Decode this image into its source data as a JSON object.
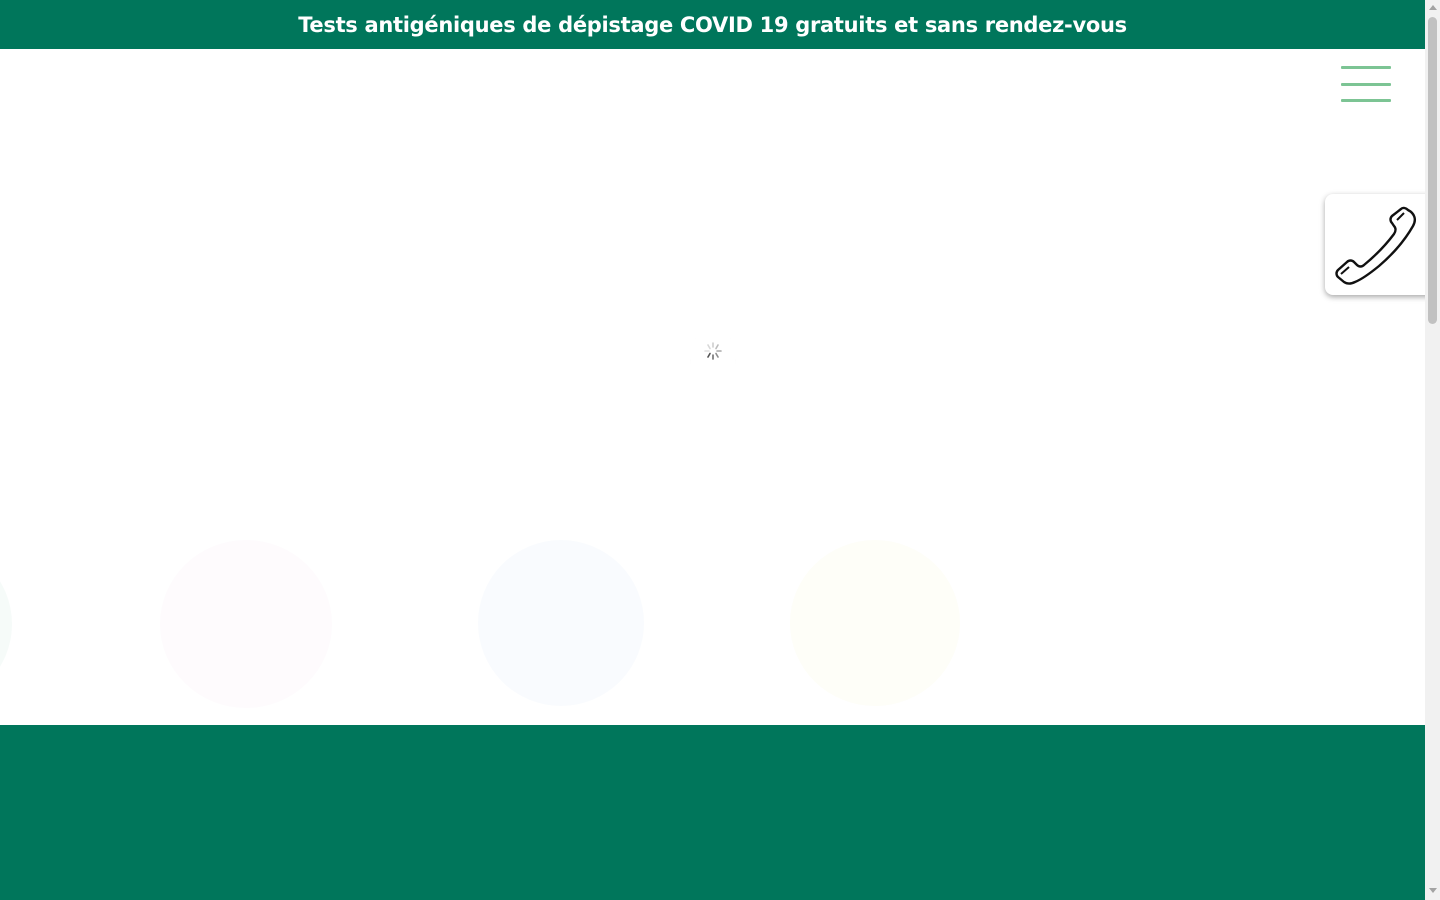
{
  "banner": {
    "text": "Tests antigéniques de dépistage COVID 19 gratuits et sans rendez-vous"
  },
  "colors": {
    "brand_green": "#00765b",
    "menu_green": "#7cc494",
    "background": "#ffffff"
  },
  "icons": {
    "menu": "hamburger-menu-icon",
    "phone": "phone-icon",
    "loader": "loading-spinner-icon"
  }
}
